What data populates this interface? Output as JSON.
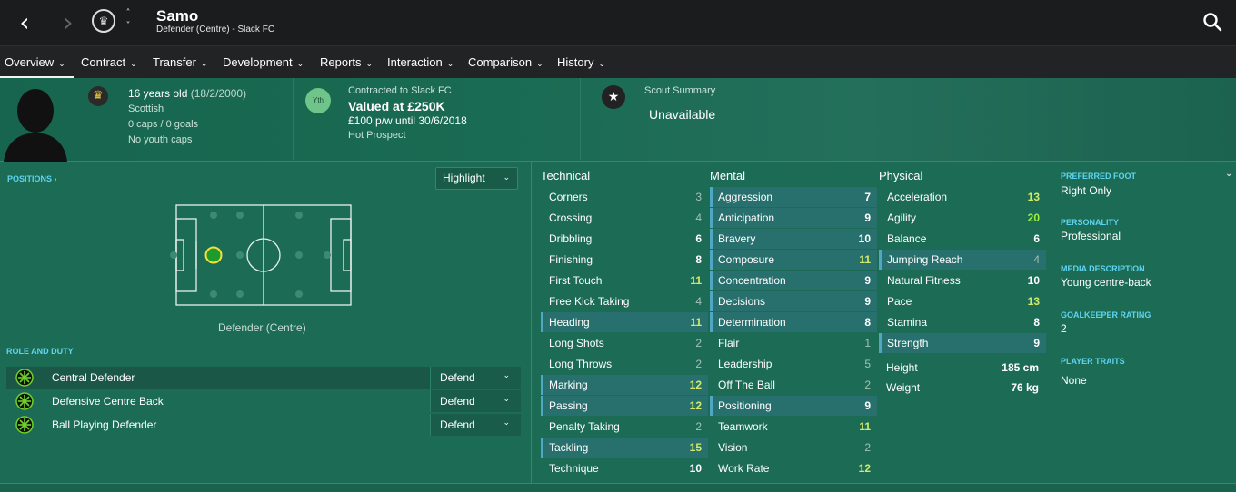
{
  "header": {
    "back_icon": "chevron-left-icon",
    "forward_icon": "chevron-right-icon",
    "club_crest_icon": "club-crest-icon",
    "player_name": "Samo",
    "player_subtitle": "Defender (Centre) - Slack FC",
    "search_icon": "search-icon"
  },
  "menu": {
    "items": [
      {
        "label": "Overview"
      },
      {
        "label": "Contract"
      },
      {
        "label": "Transfer"
      },
      {
        "label": "Development"
      },
      {
        "label": "Reports"
      },
      {
        "label": "Interaction"
      },
      {
        "label": "Comparison"
      },
      {
        "label": "History"
      }
    ],
    "active": "Overview"
  },
  "bio": {
    "age": "16 years old",
    "dob": "(18/2/2000)",
    "nationality": "Scottish",
    "caps": "0 caps / 0 goals",
    "youth_caps": "No youth caps",
    "contract_badge": "Yth",
    "contracted_to": "Contracted to Slack FC",
    "value": "Valued at £250K",
    "wage": "£100 p/w until 30/6/2018",
    "status": "Hot Prospect",
    "scout_title": "Scout Summary",
    "scout_value": "Unavailable"
  },
  "positions": {
    "label": "POSITIONS ›",
    "highlight_button": "Highlight",
    "position_caption": "Defender (Centre)"
  },
  "roles": {
    "label": "ROLE AND DUTY",
    "items": [
      {
        "role": "Central Defender",
        "duty": "Defend"
      },
      {
        "role": "Defensive Centre Back",
        "duty": "Defend"
      },
      {
        "role": "Ball Playing Defender",
        "duty": "Defend"
      }
    ]
  },
  "attributes": {
    "technical": {
      "title": "Technical",
      "items": [
        {
          "name": "Corners",
          "value": "3"
        },
        {
          "name": "Crossing",
          "value": "4"
        },
        {
          "name": "Dribbling",
          "value": "6"
        },
        {
          "name": "Finishing",
          "value": "8"
        },
        {
          "name": "First Touch",
          "value": "11"
        },
        {
          "name": "Free Kick Taking",
          "value": "4"
        },
        {
          "name": "Heading",
          "value": "11"
        },
        {
          "name": "Long Shots",
          "value": "2"
        },
        {
          "name": "Long Throws",
          "value": "2"
        },
        {
          "name": "Marking",
          "value": "12"
        },
        {
          "name": "Passing",
          "value": "12"
        },
        {
          "name": "Penalty Taking",
          "value": "2"
        },
        {
          "name": "Tackling",
          "value": "15"
        },
        {
          "name": "Technique",
          "value": "10"
        }
      ]
    },
    "mental": {
      "title": "Mental",
      "items": [
        {
          "name": "Aggression",
          "value": "7"
        },
        {
          "name": "Anticipation",
          "value": "9"
        },
        {
          "name": "Bravery",
          "value": "10"
        },
        {
          "name": "Composure",
          "value": "11"
        },
        {
          "name": "Concentration",
          "value": "9"
        },
        {
          "name": "Decisions",
          "value": "9"
        },
        {
          "name": "Determination",
          "value": "8"
        },
        {
          "name": "Flair",
          "value": "1"
        },
        {
          "name": "Leadership",
          "value": "5"
        },
        {
          "name": "Off The Ball",
          "value": "2"
        },
        {
          "name": "Positioning",
          "value": "9"
        },
        {
          "name": "Teamwork",
          "value": "11"
        },
        {
          "name": "Vision",
          "value": "2"
        },
        {
          "name": "Work Rate",
          "value": "12"
        }
      ]
    },
    "physical": {
      "title": "Physical",
      "items": [
        {
          "name": "Acceleration",
          "value": "13"
        },
        {
          "name": "Agility",
          "value": "20"
        },
        {
          "name": "Balance",
          "value": "6"
        },
        {
          "name": "Jumping Reach",
          "value": "4"
        },
        {
          "name": "Natural Fitness",
          "value": "10"
        },
        {
          "name": "Pace",
          "value": "13"
        },
        {
          "name": "Stamina",
          "value": "8"
        },
        {
          "name": "Strength",
          "value": "9"
        }
      ],
      "height_label": "Height",
      "height_value": "185 cm",
      "weight_label": "Weight",
      "weight_value": "76 kg"
    }
  },
  "profile": {
    "preferred_foot_label": "PREFERRED FOOT",
    "preferred_foot": "Right Only",
    "personality_label": "PERSONALITY",
    "personality": "Professional",
    "media_label": "MEDIA DESCRIPTION",
    "media": "Young centre-back",
    "gk_label": "GOALKEEPER RATING",
    "gk": "2",
    "traits_label": "PLAYER TRAITS",
    "traits": "None"
  }
}
